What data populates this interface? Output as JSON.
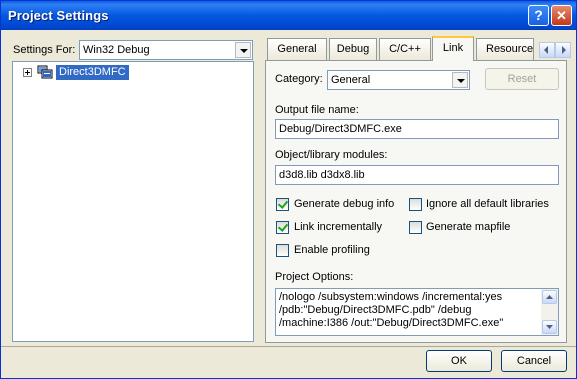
{
  "window": {
    "title": "Project Settings",
    "help_glyph": "?",
    "close_glyph": "✕"
  },
  "settings_for": {
    "label": "Settings For:",
    "value": "Win32 Debug"
  },
  "tree": {
    "items": [
      {
        "label": "Direct3DMFC",
        "selected": true
      }
    ]
  },
  "tabs": [
    {
      "label": "General",
      "active": false
    },
    {
      "label": "Debug",
      "active": false
    },
    {
      "label": "C/C++",
      "active": false
    },
    {
      "label": "Link",
      "active": true
    },
    {
      "label": "Resource",
      "active": false
    }
  ],
  "link": {
    "category_label": "Category:",
    "category_value": "General",
    "reset_label": "Reset",
    "output_file_label": "Output file name:",
    "output_file_value": "Debug/Direct3DMFC.exe",
    "modules_label": "Object/library modules:",
    "modules_value": "d3d8.lib d3dx8.lib",
    "checkboxes": {
      "generate_debug_info": {
        "label": "Generate debug info",
        "checked": true
      },
      "ignore_default_libs": {
        "label": "Ignore all default libraries",
        "checked": false
      },
      "link_incrementally": {
        "label": "Link incrementally",
        "checked": true
      },
      "generate_mapfile": {
        "label": "Generate mapfile",
        "checked": false
      },
      "enable_profiling": {
        "label": "Enable profiling",
        "checked": false
      }
    },
    "project_options_label": "Project Options:",
    "project_options_lines": [
      "/nologo /subsystem:windows /incremental:yes",
      "/pdb:\"Debug/Direct3DMFC.pdb\" /debug",
      "/machine:I386 /out:\"Debug/Direct3DMFC.exe\""
    ]
  },
  "footer": {
    "ok_label": "OK",
    "cancel_label": "Cancel"
  },
  "colors": {
    "title_bar": "#0458e0",
    "selection": "#316ac5",
    "active_tab_accent": "#ffc83c"
  }
}
